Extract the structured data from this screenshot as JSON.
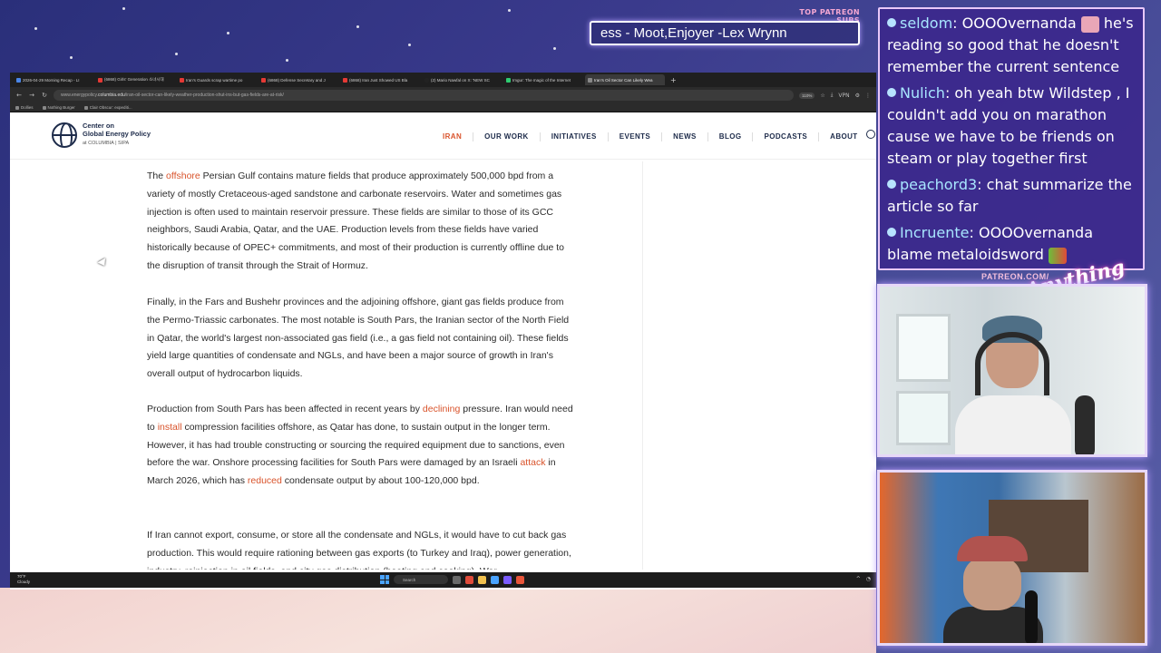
{
  "overlay": {
    "subs_title": "TOP PATREON SUBS",
    "subs_ticker": "ess - Moot,Enjoyer -Lex Wrynn",
    "patreon_url": "PATREON.COM/",
    "brand_script": "Anything Else"
  },
  "browser": {
    "tabs": [
      {
        "label": "2026-04-29 Morning Recap - LI",
        "color": "#4a86e8"
      },
      {
        "label": "(6868) Girls' Generation 소녀시대",
        "color": "#e53935"
      },
      {
        "label": "Iran's Guards scrap wartime po",
        "color": "#e53935"
      },
      {
        "label": "(6868) Defense Secretary and J",
        "color": "#e53935"
      },
      {
        "label": "(6868) Iran Just Showed US Bla",
        "color": "#e53935"
      },
      {
        "label": "(2) Mario Nawfal on X: 'NEW SC",
        "color": "#222222"
      },
      {
        "label": "Imgur: The magic of the Internet",
        "color": "#2ecc71"
      },
      {
        "label": "Iran's Oil Sector Can Likely Wea",
        "color": "#888888"
      }
    ],
    "url_prefix": "www.energypolicy.",
    "url_domain": "columbia.edu",
    "url_path": "/iran-oil-sector-can-likely-weather-production-shut-ins-but-gas-fields-are-at-risk/",
    "zoom": "110%",
    "vpn": "VPN",
    "bookmarks": [
      "Dollies",
      "Nothing Burger",
      "Clair Obscur: expediti..."
    ]
  },
  "site": {
    "logo_line1": "Center on",
    "logo_line2": "Global Energy Policy",
    "logo_line3": "at COLUMBIA | SIPA",
    "nav": [
      "IRAN",
      "OUR WORK",
      "INITIATIVES",
      "EVENTS",
      "NEWS",
      "BLOG",
      "PODCASTS",
      "ABOUT"
    ]
  },
  "article": {
    "p1_before": "The ",
    "p1_link": "offshore",
    "p1_after": " Persian Gulf contains mature fields that produce approximately 500,000 bpd from a variety of mostly Cretaceous-aged sandstone and carbonate reservoirs. Water and sometimes gas injection is often used to maintain reservoir pressure. These fields are similar to those of its GCC neighbors, Saudi Arabia, Qatar, and the UAE. Production levels from these fields have varied historically because of OPEC+ commitments, and most of their production is currently offline due to the disruption of transit through the Strait of Hormuz.",
    "p2": "Finally, in the Fars and Bushehr provinces and the adjoining offshore, giant gas fields produce from the Permo-Triassic carbonates. The most notable is South Pars, the Iranian sector of the North Field in Qatar, the world's largest non-associated gas field (i.e., a gas field not containing oil). These fields yield large quantities of condensate and NGLs, and have been a major source of growth in Iran's overall output of hydrocarbon liquids.",
    "p3_a": "Production from South Pars has been affected in recent years by ",
    "p3_link1": "declining",
    "p3_b": " pressure. Iran would need to ",
    "p3_link2": "install",
    "p3_c": " compression facilities offshore, as Qatar has done, to sustain output in the longer term. However, it has had trouble constructing or sourcing the required equipment due to sanctions, even before the war. Onshore processing facilities for South Pars were damaged by an Israeli ",
    "p3_link3": "attack",
    "p3_d": " in March 2026, which has ",
    "p3_link4": "reduced",
    "p3_e": " condensate output by about 100-120,000 bpd.",
    "p4": "If Iran cannot export, consume, or store all the condensate and NGLs, it would have to cut back gas production. This would require rationing between gas exports (to Turkey and Iraq), power generation, industry, reinjection in oil fields, and city gas distribution (heating and cooking). War"
  },
  "taskbar": {
    "temp": "70°F",
    "weather": "Cloudy",
    "search": "Search"
  },
  "chat": [
    {
      "user": "seldom",
      "text": "OOOOvernanda",
      "text2": " he's reading so good that he doesn't remember the current sentence"
    },
    {
      "user": "Nulich",
      "text": "oh yeah btw Wildstep , I couldn't add you on marathon cause we have to be friends on steam or play together first",
      "text2": ""
    },
    {
      "user": "peachord3",
      "text": "chat summarize the article so far",
      "text2": ""
    },
    {
      "user": "Incruente",
      "text": "OOOOvernanda blame metaloidsword",
      "text2": ""
    }
  ]
}
